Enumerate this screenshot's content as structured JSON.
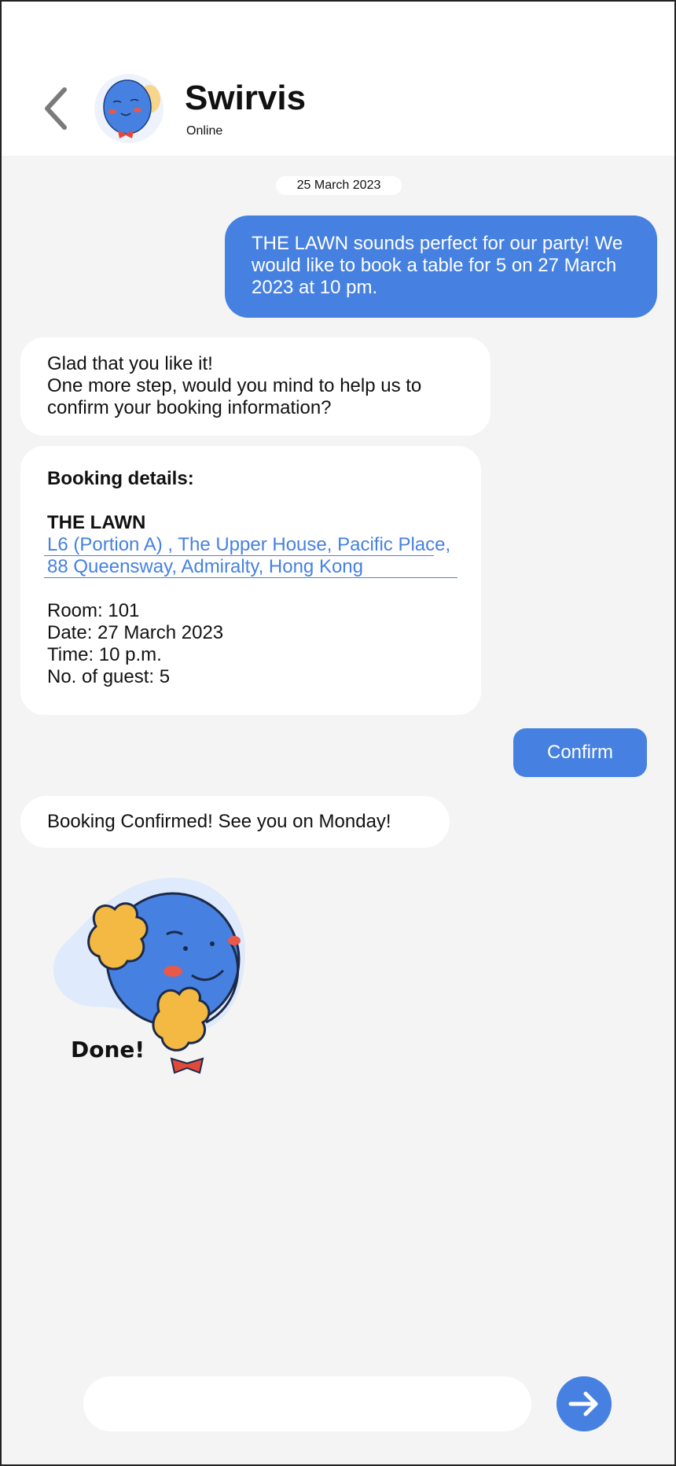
{
  "header": {
    "title": "Swirvis",
    "status": "Online"
  },
  "chat": {
    "date": "25 March 2023",
    "outgoing_message": "THE LAWN sounds perfect for our party! We would like to book a table for 5 on 27 March 2023 at 10 pm.",
    "incoming_message_1": [
      "Glad that you like it!",
      "One more step, would you mind to help us to confirm your booking information?"
    ],
    "booking_card": {
      "heading": "Booking details:",
      "venue_name": "THE LAWN",
      "address": "L6 (Portion A) , The Upper House, Pacific Place, 88 Queensway, Admiralty, Hong Kong",
      "room": "Room: 101",
      "date": "Date: 27 March 2023",
      "time": "Time: 10 p.m.",
      "guests": "No. of guest: 5"
    },
    "confirm_button": "Confirm",
    "incoming_message_2": "Booking Confirmed! See you on Monday!",
    "sticker_text": "Done!"
  },
  "composer": {
    "input_value": "",
    "send_icon": "arrow-right-icon"
  },
  "colors": {
    "accent": "#4681e1",
    "background": "#f4f4f4",
    "bubble": "#ffffff"
  }
}
